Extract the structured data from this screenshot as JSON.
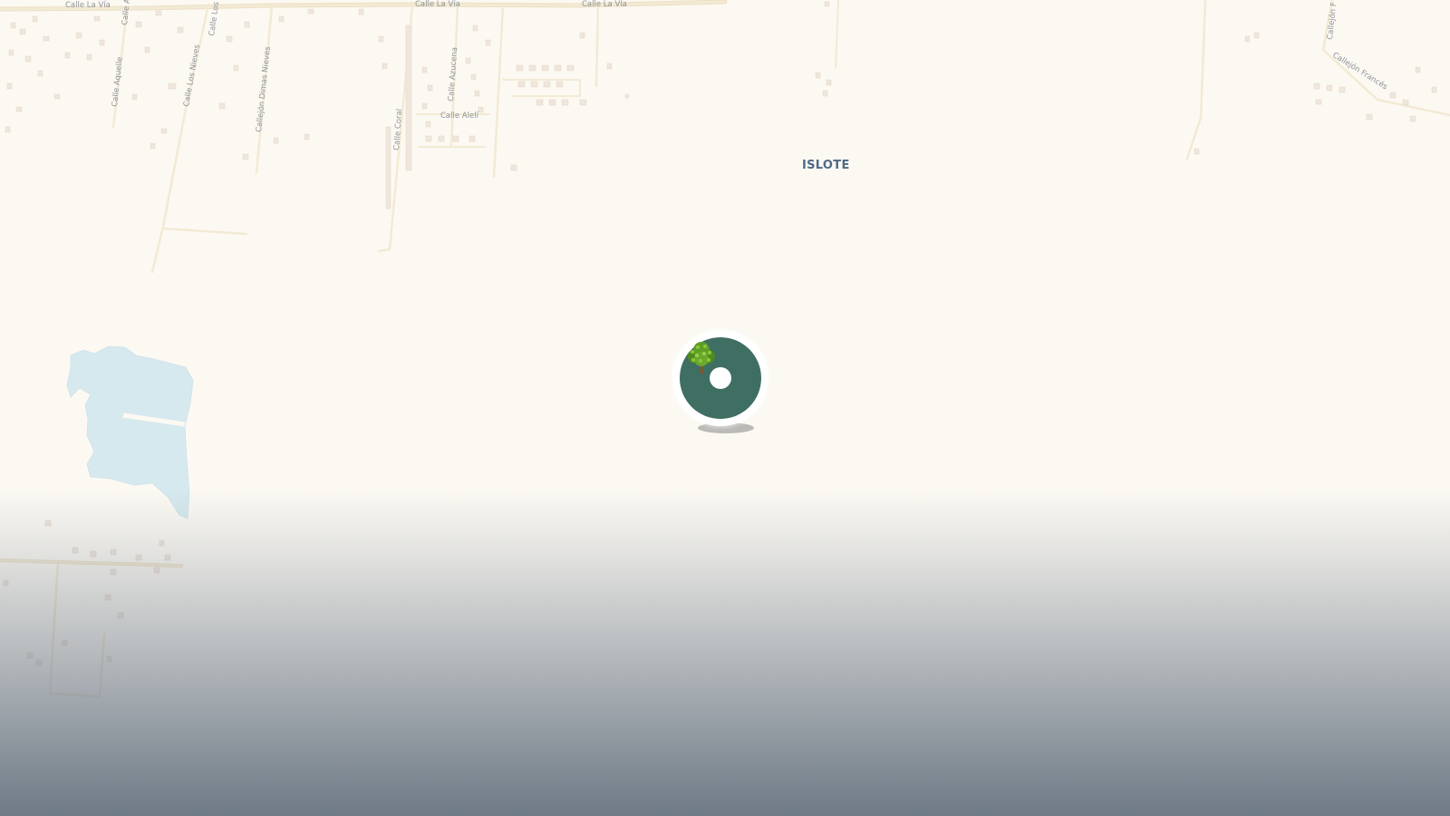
{
  "map": {
    "place_label": "ISLOTE",
    "streets": {
      "la_via_1": "Calle La Vía",
      "la_via_2": "Calle La Vía",
      "la_via_3": "Calle La Vía",
      "aquelle": "Calle Aquelle",
      "calle_a": "Calle A",
      "calle_los": "Calle Los",
      "los_nieves": "Calle Los Nieves",
      "dimas_nieves": "Callejón Dimas Nieves",
      "coral": "Calle Coral",
      "azucena": "Calle Azucena",
      "aleli": "Calle Alelí",
      "callejon_f": "Callejón F",
      "frances": "Callejón Francés"
    },
    "colors": {
      "land": "#fcf9f3",
      "water": "#d6e9ee",
      "road": "#f3ead4",
      "building": "#efe6dc",
      "street_label": "#8d9298",
      "place_label": "#4f6a85",
      "fade_bottom": "#6e7a86"
    }
  },
  "marker": {
    "icon": "tree-icon",
    "colors": {
      "ring": "#ffffff",
      "core": "#3f6e63",
      "hole": "#ffffff"
    }
  }
}
